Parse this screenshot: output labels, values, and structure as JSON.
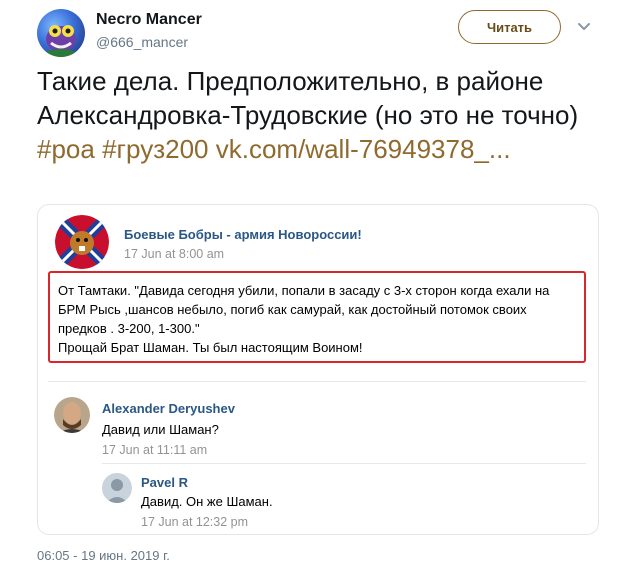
{
  "tweet": {
    "author_name": "Necro Mancer",
    "author_handle": "@666_mancer",
    "follow_label": "Читать",
    "text_plain": "Такие дела. Предположительно, в районе Александровка-Трудовские (но это не точно) ",
    "hashtag_1": "#роа",
    "hashtag_2": "#груз200",
    "link": "vk.com/wall-76949378_...",
    "timestamp": "06:05 - 19 июн. 2019 г."
  },
  "embedded_post": {
    "author": "Боевые Бобры - армия Новороссии!",
    "date": "17 Jun at 8:00 am",
    "body_line_1": "От Тамтаки. \"Давида сегодня убили, попали в засаду с 3-х сторон когда ехали на БРМ Рысь ,шансов небыло, погиб как самурай, как достойный потомок своих предков . 3-200, 1-300.\"",
    "body_line_2": "Прощай Брат Шаман. Ты был настоящим Воином!",
    "comments": [
      {
        "author": "Alexander Deryushev",
        "text": "Давид или Шаман?",
        "date": "17 Jun at 11:11 am"
      },
      {
        "author": "Pavel R",
        "text": "Давид. Он же Шаман.",
        "date": "17 Jun at 12:32 pm"
      }
    ]
  },
  "colors": {
    "accent": "#8f6a2f",
    "vk_link": "#2a5885",
    "highlight_border": "#d8262a",
    "muted": "#657786"
  }
}
